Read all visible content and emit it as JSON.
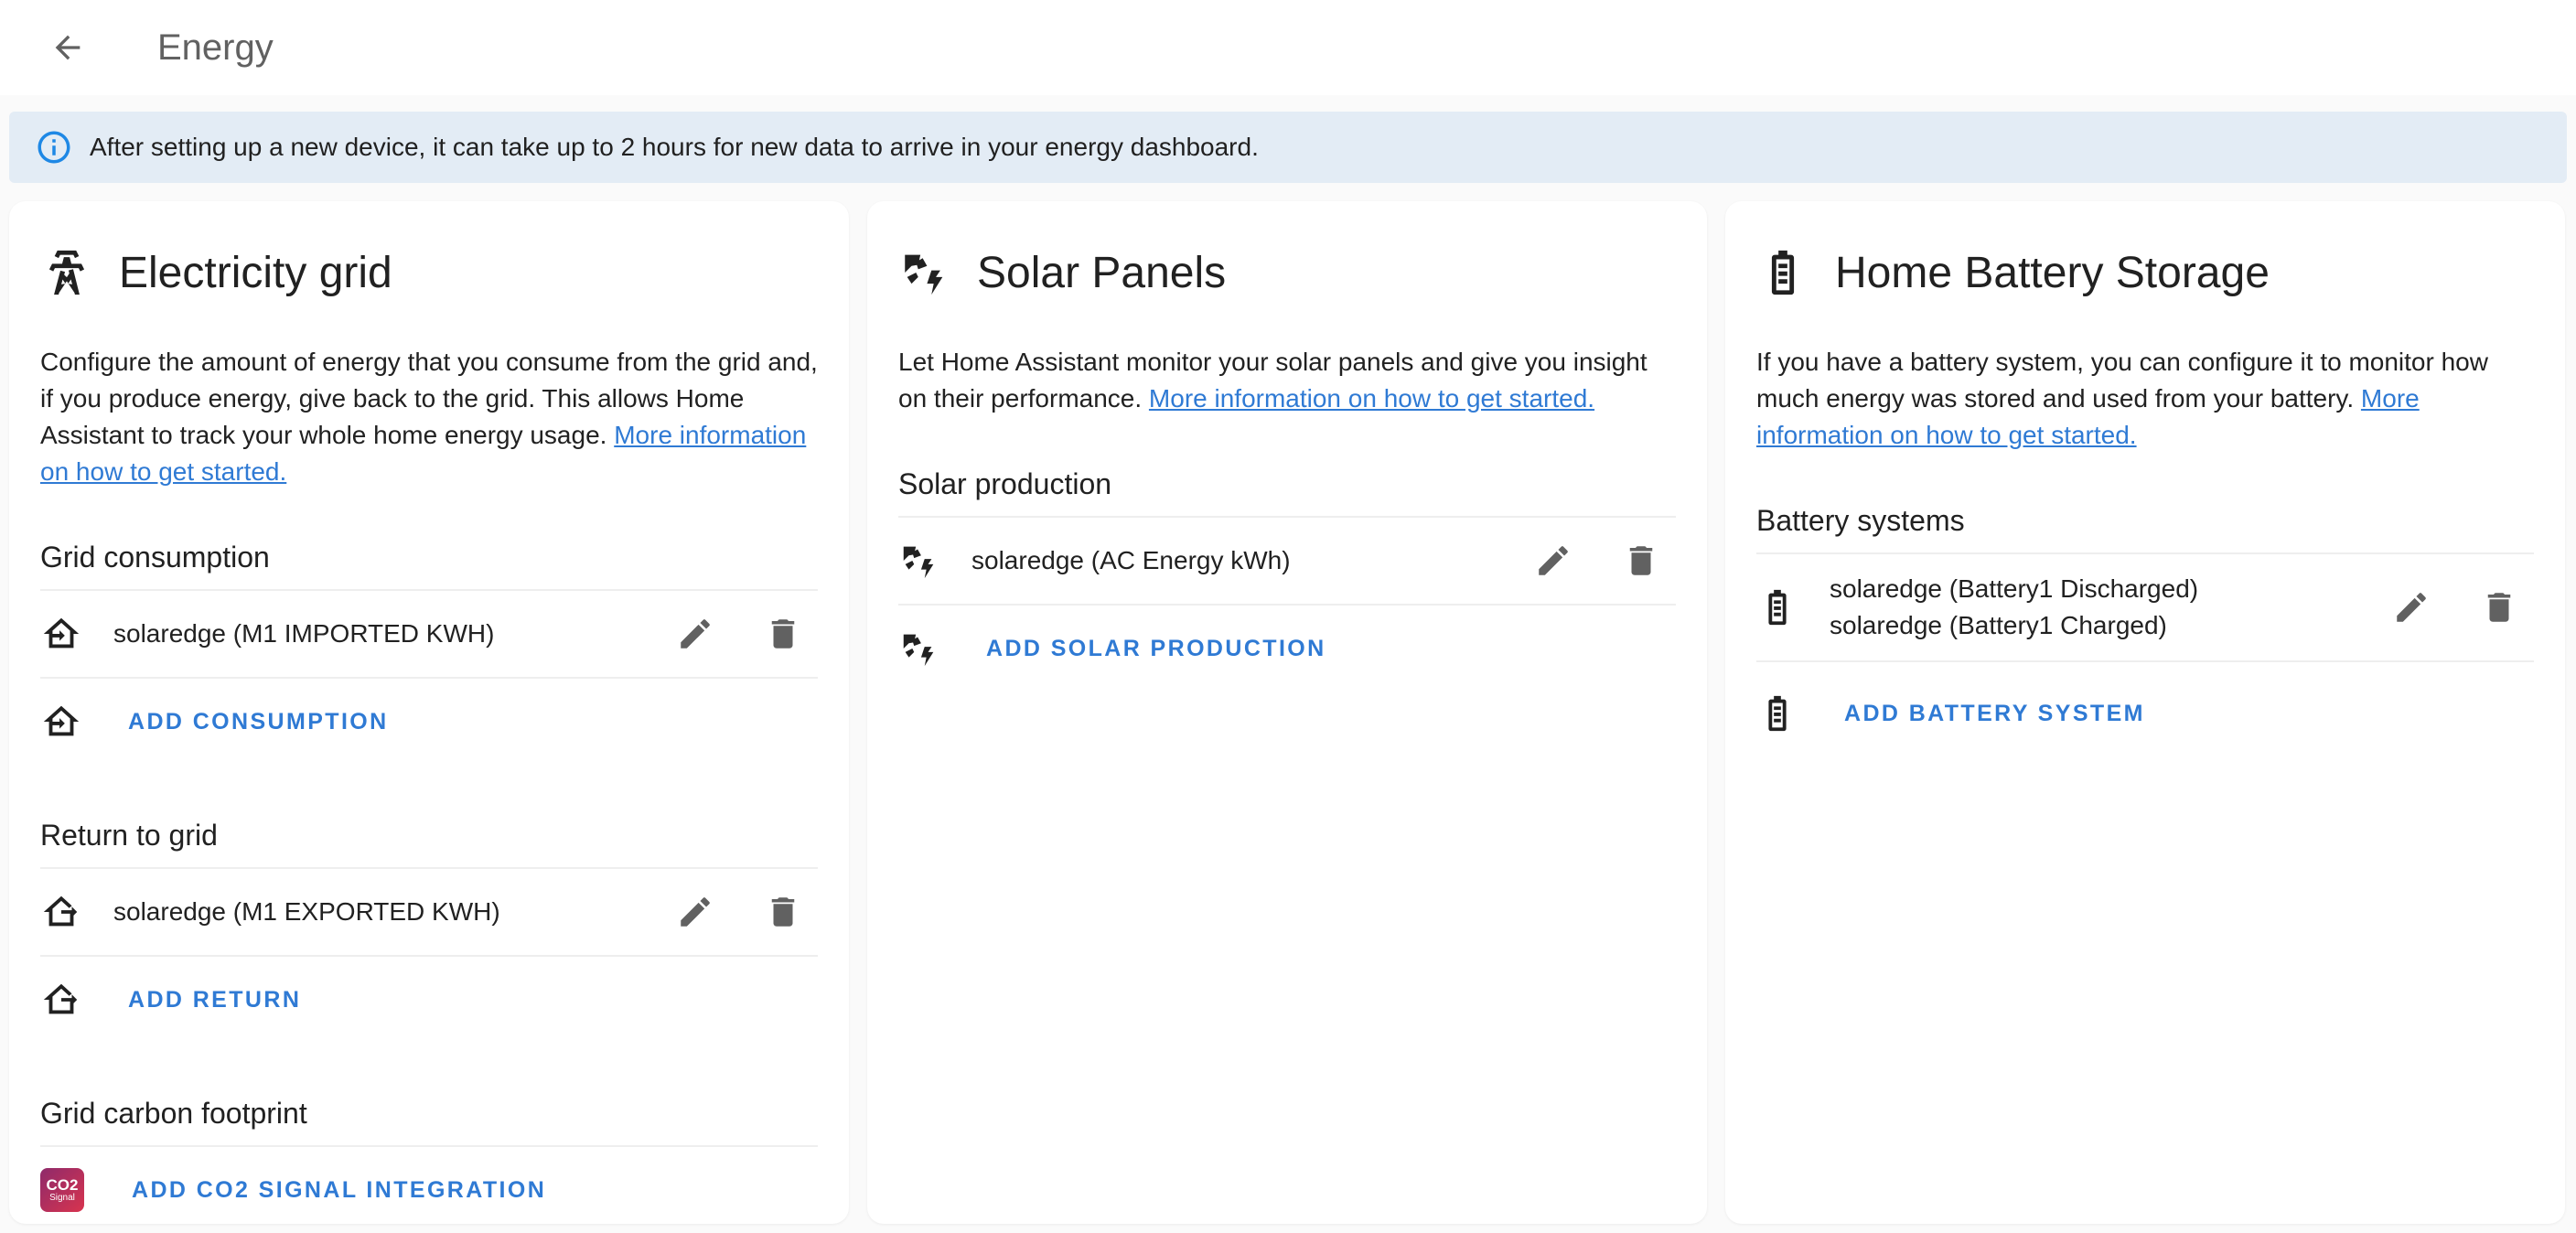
{
  "header": {
    "title": "Energy"
  },
  "alert": {
    "text": "After setting up a new device, it can take up to 2 hours for new data to arrive in your energy dashboard."
  },
  "grid_card": {
    "title": "Electricity grid",
    "desc": "Configure the amount of energy that you consume from the grid and, if you produce energy, give back to the grid. This allows Home Assistant to track your whole home energy usage. ",
    "link": "More information on how to get started.",
    "consumption_title": "Grid consumption",
    "consumption_item": "solaredge (M1 IMPORTED KWH)",
    "add_consumption": "ADD CONSUMPTION",
    "return_title": "Return to grid",
    "return_item": "solaredge (M1 EXPORTED KWH)",
    "add_return": "ADD RETURN",
    "carbon_title": "Grid carbon footprint",
    "co2_logo_main": "CO2",
    "co2_logo_sub": "Signal",
    "add_co2": "ADD CO2 SIGNAL INTEGRATION"
  },
  "solar_card": {
    "title": "Solar Panels",
    "desc": "Let Home Assistant monitor your solar panels and give you insight on their performance. ",
    "link": "More information on how to get started.",
    "production_title": "Solar production",
    "production_item": "solaredge (AC Energy kWh)",
    "add_production": "ADD SOLAR PRODUCTION"
  },
  "battery_card": {
    "title": "Home Battery Storage",
    "desc": "If you have a battery system, you can configure it to monitor how much energy was stored and used from your battery. ",
    "link": "More information on how to get started.",
    "systems_title": "Battery systems",
    "item_line1": "solaredge (Battery1 Discharged)",
    "item_line2": "solaredge (Battery1 Charged)",
    "add_battery": "ADD BATTERY SYSTEM"
  },
  "colors": {
    "accent": "#2f7ad4",
    "alert_bg": "#e3ecf5",
    "info_icon": "#1e88e5"
  }
}
